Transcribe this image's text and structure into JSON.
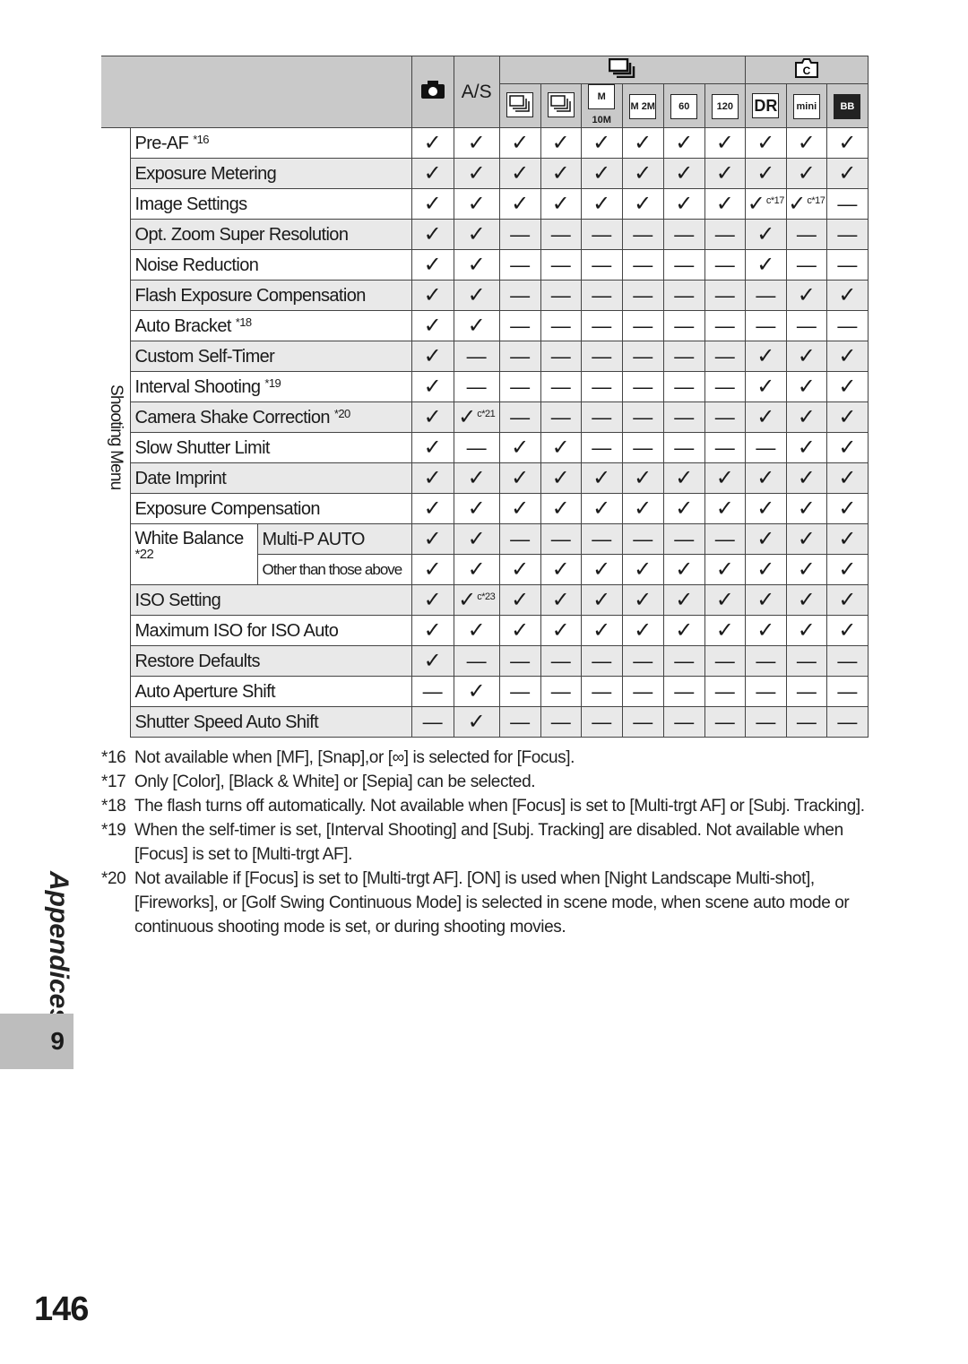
{
  "header": {
    "col_still": {
      "icon": "camera-icon"
    },
    "col_as": "A/S",
    "group_continuous": {
      "icon": "continuous-icon"
    },
    "group_scene": {
      "icon": "scene-c-icon"
    },
    "sub_icons": [
      {
        "icon": "continuous-icon",
        "text": ""
      },
      {
        "icon": "s-continuous-icon",
        "text": ""
      },
      {
        "icon": "m-cont-10m-icon",
        "text": "M 10M"
      },
      {
        "icon": "m-cont-2m-icon",
        "text": "M 2M"
      },
      {
        "icon": "cont-60-icon",
        "text": "60"
      },
      {
        "icon": "cont-120-icon",
        "text": "120"
      },
      {
        "icon": "dr-icon",
        "text": "DR"
      },
      {
        "icon": "mini-icon",
        "text": "mini"
      },
      {
        "icon": "bb-icon",
        "text": "BB"
      }
    ]
  },
  "side_label": "Shooting Menu",
  "symbols": {
    "c": "✓",
    "d": "—"
  },
  "rows": [
    {
      "label": "Pre-AF",
      "note": "*16",
      "cells": [
        "c",
        "c",
        "c",
        "c",
        "c",
        "c",
        "c",
        "c",
        "c",
        "c",
        "c"
      ]
    },
    {
      "label": "Exposure Metering",
      "cells": [
        "c",
        "c",
        "c",
        "c",
        "c",
        "c",
        "c",
        "c",
        "c",
        "c",
        "c"
      ]
    },
    {
      "label": "Image Settings",
      "cells": [
        "c",
        "c",
        "c",
        "c",
        "c",
        "c",
        "c",
        "c",
        "c*17",
        "c*17",
        "d"
      ]
    },
    {
      "label": "Opt. Zoom Super Resolution",
      "cells": [
        "c",
        "c",
        "d",
        "d",
        "d",
        "d",
        "d",
        "d",
        "c",
        "d",
        "d"
      ]
    },
    {
      "label": "Noise Reduction",
      "cells": [
        "c",
        "c",
        "d",
        "d",
        "d",
        "d",
        "d",
        "d",
        "c",
        "d",
        "d"
      ]
    },
    {
      "label": "Flash Exposure Compensation",
      "cells": [
        "c",
        "c",
        "d",
        "d",
        "d",
        "d",
        "d",
        "d",
        "d",
        "c",
        "c"
      ]
    },
    {
      "label": "Auto Bracket",
      "note": "*18",
      "cells": [
        "c",
        "c",
        "d",
        "d",
        "d",
        "d",
        "d",
        "d",
        "d",
        "d",
        "d"
      ]
    },
    {
      "label": "Custom Self-Timer",
      "cells": [
        "c",
        "d",
        "d",
        "d",
        "d",
        "d",
        "d",
        "d",
        "c",
        "c",
        "c"
      ]
    },
    {
      "label": "Interval Shooting",
      "note": "*19",
      "cells": [
        "c",
        "d",
        "d",
        "d",
        "d",
        "d",
        "d",
        "d",
        "c",
        "c",
        "c"
      ]
    },
    {
      "label": "Camera Shake Correction",
      "note": "*20",
      "cells": [
        "c",
        "c*21",
        "d",
        "d",
        "d",
        "d",
        "d",
        "d",
        "c",
        "c",
        "c"
      ]
    },
    {
      "label": "Slow Shutter Limit",
      "cells": [
        "c",
        "d",
        "c",
        "c",
        "d",
        "d",
        "d",
        "d",
        "d",
        "c",
        "c"
      ]
    },
    {
      "label": "Date Imprint",
      "cells": [
        "c",
        "c",
        "c",
        "c",
        "c",
        "c",
        "c",
        "c",
        "c",
        "c",
        "c"
      ]
    },
    {
      "label": "Exposure Compensation",
      "cells": [
        "c",
        "c",
        "c",
        "c",
        "c",
        "c",
        "c",
        "c",
        "c",
        "c",
        "c"
      ]
    },
    {
      "label": "White Balance",
      "note": "*22",
      "sub": "Multi-P AUTO",
      "cells": [
        "c",
        "c",
        "d",
        "d",
        "d",
        "d",
        "d",
        "d",
        "c",
        "c",
        "c"
      ]
    },
    {
      "sub": "Other than those above",
      "cells": [
        "c",
        "c",
        "c",
        "c",
        "c",
        "c",
        "c",
        "c",
        "c",
        "c",
        "c"
      ]
    },
    {
      "label": "ISO Setting",
      "cells": [
        "c",
        "c*23",
        "c",
        "c",
        "c",
        "c",
        "c",
        "c",
        "c",
        "c",
        "c"
      ]
    },
    {
      "label": "Maximum ISO for ISO Auto",
      "cells": [
        "c",
        "c",
        "c",
        "c",
        "c",
        "c",
        "c",
        "c",
        "c",
        "c",
        "c"
      ]
    },
    {
      "label": "Restore Defaults",
      "cells": [
        "c",
        "d",
        "d",
        "d",
        "d",
        "d",
        "d",
        "d",
        "d",
        "d",
        "d"
      ]
    },
    {
      "label": "Auto Aperture Shift",
      "cells": [
        "d",
        "c",
        "d",
        "d",
        "d",
        "d",
        "d",
        "d",
        "d",
        "d",
        "d"
      ]
    },
    {
      "label": "Shutter Speed Auto Shift",
      "cells": [
        "d",
        "c",
        "d",
        "d",
        "d",
        "d",
        "d",
        "d",
        "d",
        "d",
        "d"
      ]
    }
  ],
  "footnotes": [
    {
      "key": "*16",
      "text": "Not available when [MF], [Snap],or [∞] is selected for [Focus]."
    },
    {
      "key": "*17",
      "text": "Only [Color], [Black & White] or [Sepia] can be selected."
    },
    {
      "key": "*18",
      "text": "The flash turns off automatically. Not available when [Focus] is set to [Multi-trgt AF] or [Subj. Tracking]."
    },
    {
      "key": "*19",
      "text": "When the self-timer is set, [Interval Shooting] and [Subj. Tracking] are disabled. Not available when [Focus] is set to [Multi-trgt AF]."
    },
    {
      "key": "*20",
      "text": "Not available if [Focus] is set to [Multi-trgt AF]. [ON] is used when [Night Landscape Multi-shot], [Fireworks], or [Golf Swing Continuous Mode] is selected in scene mode, when scene auto mode or continuous shooting mode is set, or during shooting movies."
    }
  ],
  "section": "Appendices",
  "chapter_number": "9",
  "page_number": "146"
}
